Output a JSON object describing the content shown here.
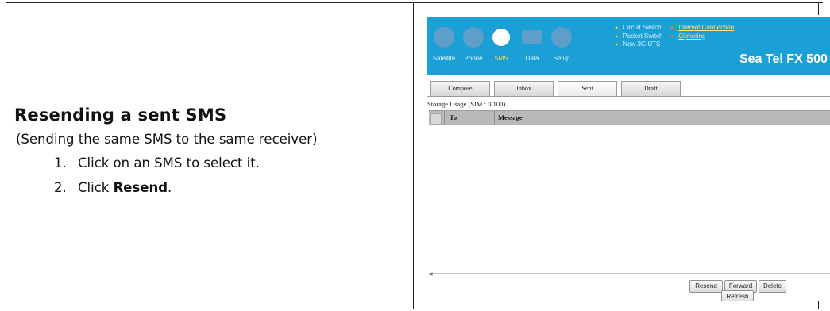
{
  "instructions": {
    "heading": "Resending a sent SMS",
    "subtitle": "(Sending the same SMS to the same receiver)",
    "steps": [
      {
        "num": "1.",
        "text": "Click on an SMS to select it."
      },
      {
        "num": "2.",
        "prefix": "Click ",
        "bold": "Resend",
        "suffix": "."
      }
    ]
  },
  "app": {
    "nav": [
      {
        "label": "Satellite",
        "icon": "satellite-icon",
        "color": "#7fb7d9"
      },
      {
        "label": "Phone",
        "icon": "phone-icon",
        "color": "#7fb7d9"
      },
      {
        "label": "SMS",
        "icon": "sms-icon",
        "color": "#ffffff"
      },
      {
        "label": "Data",
        "icon": "data-icon",
        "color": "#7fb7d9"
      },
      {
        "label": "Setup",
        "icon": "setup-icon",
        "color": "#7fb7d9"
      }
    ],
    "status_left": [
      "Circuit Switch",
      "Packet Switch",
      "New 3G UTS"
    ],
    "status_right": [
      "Internet Connection",
      "Ciphering"
    ],
    "brand": "Sea Tel FX 500",
    "tabs": [
      "Compose",
      "Inbox",
      "Sent",
      "Draft"
    ],
    "active_tab": "Sent",
    "storage_usage": "Storage Usage (SIM : 0/100)",
    "columns": [
      "To",
      "Message"
    ],
    "buttons": {
      "resend": "Resend",
      "forward": "Forward",
      "delete": "Delete",
      "refresh": "Refresh"
    },
    "colors": {
      "topbar": "#1aa0d6",
      "active_nav": "#ffd84a",
      "brand": "#ffffff"
    }
  }
}
